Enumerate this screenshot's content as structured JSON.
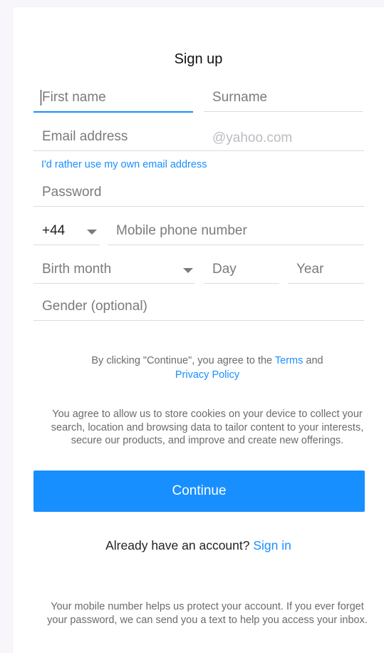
{
  "title": "Sign up",
  "fields": {
    "first_name": "First name",
    "surname": "Surname",
    "email": "Email address",
    "email_suffix": "@yahoo.com",
    "own_email_link": "I'd rather use my own email address",
    "password": "Password",
    "country_code": "+44",
    "mobile": "Mobile phone number",
    "birth_month": "Birth month",
    "day": "Day",
    "year": "Year",
    "gender": "Gender (optional)"
  },
  "terms": {
    "prefix": "By clicking \"Continue\", you agree to the ",
    "terms_link": "Terms",
    "and": " and",
    "privacy_link": "Privacy Policy"
  },
  "cookies_text": "You agree to allow us to store cookies on your device to collect your search, location and browsing data to tailor content to your interests, secure our products, and improve and create new offerings.",
  "continue_label": "Continue",
  "already": {
    "text": "Already have an account? ",
    "sign_in": "Sign in"
  },
  "footer_text": "Your mobile number helps us protect your account. If you ever forget your password, we can send you a text to help you access your inbox.",
  "colors": {
    "accent": "#188fff",
    "background": "#f8f6fb"
  }
}
